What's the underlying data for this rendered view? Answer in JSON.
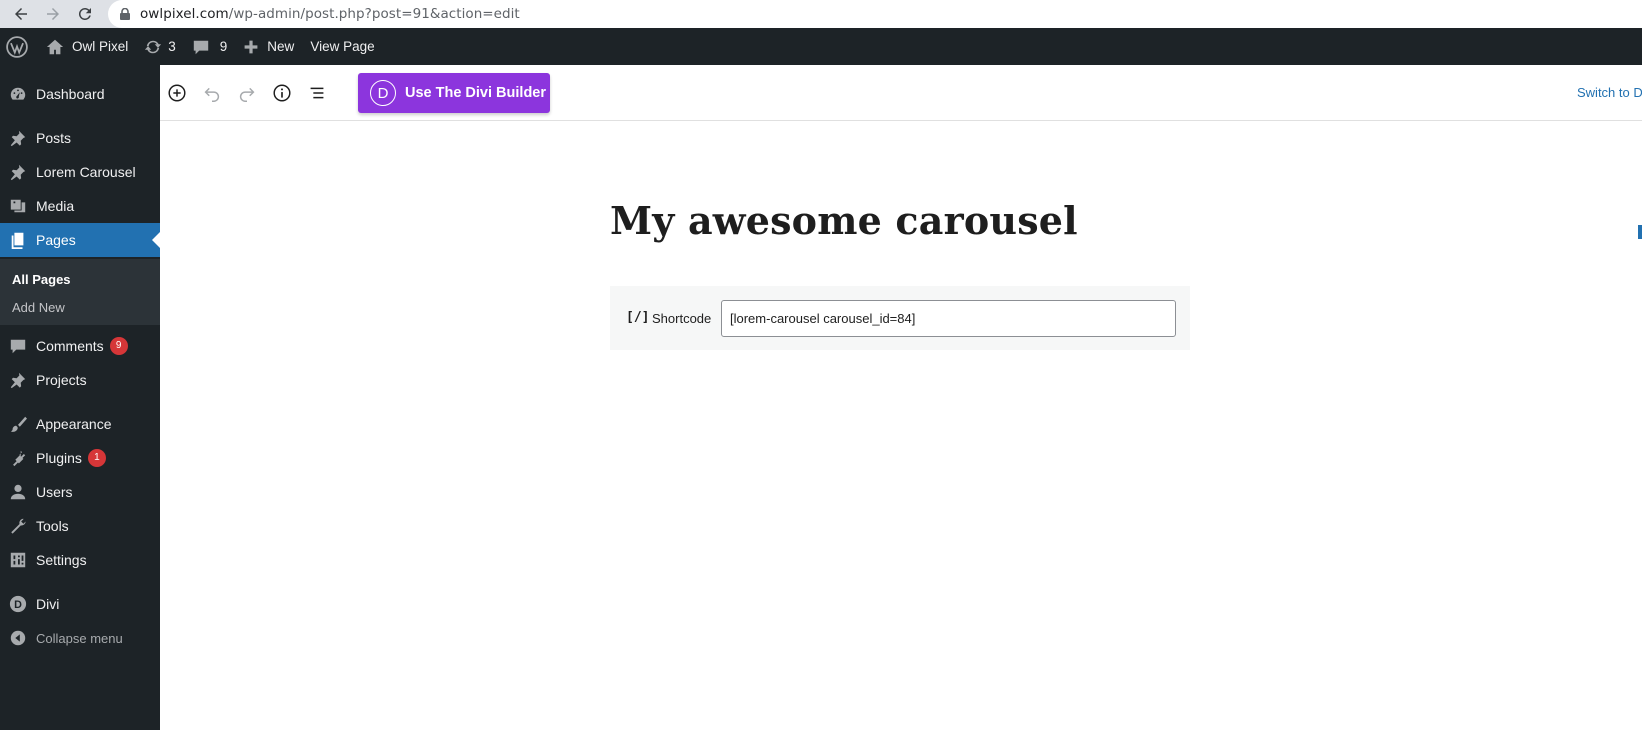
{
  "browser": {
    "url_host": "owlpixel.com",
    "url_path": "/wp-admin/post.php?post=91&action=edit"
  },
  "admin_bar": {
    "site_name": "Owl Pixel",
    "updates_count": "3",
    "comments_count": "9",
    "new_label": "New",
    "view_page_label": "View Page"
  },
  "sidebar": {
    "items": {
      "dashboard": "Dashboard",
      "posts": "Posts",
      "lorem_carousel": "Lorem Carousel",
      "media": "Media",
      "pages": "Pages",
      "comments": "Comments",
      "comments_badge": "9",
      "projects": "Projects",
      "appearance": "Appearance",
      "plugins": "Plugins",
      "plugins_badge": "1",
      "users": "Users",
      "tools": "Tools",
      "settings": "Settings",
      "divi": "Divi",
      "collapse": "Collapse menu"
    },
    "submenu": {
      "all_pages": "All Pages",
      "add_new": "Add New"
    }
  },
  "editor": {
    "divi_button_label": "Use The Divi Builder",
    "divi_logo_letter": "D",
    "switch_link": "Switch to D",
    "post_title": "My awesome carousel",
    "shortcode": {
      "icon_text": "[/]",
      "label": "Shortcode",
      "value": "[lorem-carousel carousel_id=84]"
    }
  },
  "colors": {
    "admin_dark": "#1d2327",
    "active_blue": "#2271b1",
    "divi_purple": "#8c35dd",
    "badge_red": "#d63638"
  }
}
